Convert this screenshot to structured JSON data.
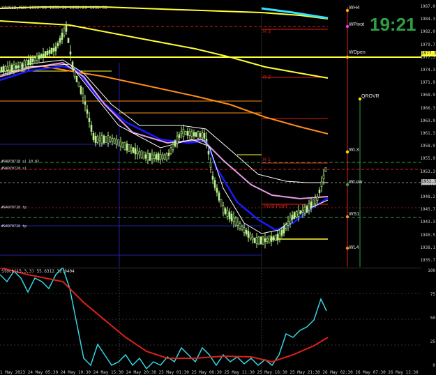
{
  "header": {
    "info": "XAUUSD,M30  1953.08 1953.30 1952.29 1952.33"
  },
  "clock": {
    "time": "19:21"
  },
  "stoch": {
    "header": "Stoch(15,3,3) 55.6312 32.9404"
  },
  "price_axis": [
    "1987.0",
    "1984.3",
    "1982.0",
    "1979.7",
    "1977.3",
    "1974.3",
    "1971.9",
    "1968.9",
    "1966.3",
    "1963.9",
    "1961.3",
    "1958.9",
    "1955.9",
    "1953.3",
    "1950.6",
    "1948.2",
    "1945.7",
    "1943.3",
    "1940.5",
    "1938.1",
    "1935.7"
  ],
  "price_tags": [
    {
      "text": "1977.3",
      "bg": "#ffff33"
    },
    {
      "text": "1952.3",
      "bg": "#c0c0c0"
    }
  ],
  "stoch_axis": [
    "100",
    "75",
    "50",
    "25",
    "0"
  ],
  "time_axis": "1 May 2023  24 May 05:30  24 May 10:30  24 May 15:30  24 May 20:30  25 May 01:30  25 May 06:30  25 May 11:30  25 May 16:30  25 May 21:30  26 May 02:30  26 May 07:30  26 May 12:30",
  "levels": {
    "wpivot": "WPivot",
    "wopen": "WOpen",
    "wh": "WH4",
    "qrovr": "QROVR",
    "wl3": "WL3",
    "wlow": "WLow",
    "ws1": "WS1",
    "wl4": "WL4",
    "r3": "R 3",
    "r2": "R 2",
    "r1": "R 1",
    "pivot": "Pivot Point"
  },
  "orders": [
    "#94970728 sl  10.02",
    "#94970728 sl",
    "#94970728 tp",
    "#94970726 tp"
  ],
  "colors": {
    "candle": "#b8f28c",
    "blue": "#1a1aff",
    "pink": "#e79ce6",
    "white": "#ffffff",
    "yellow": "#ffff33",
    "orange": "#ff8c1a",
    "cyan": "#33e0ff",
    "red": "#e0201a",
    "green": "#2ea043",
    "stoch_main": "#35d6e6",
    "stoch_signal": "#e0201a"
  }
}
